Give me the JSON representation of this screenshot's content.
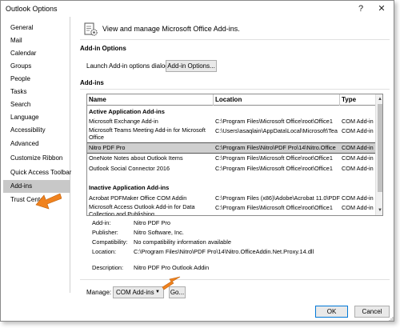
{
  "window": {
    "title": "Outlook Options",
    "help_glyph": "?",
    "close_glyph": "✕"
  },
  "sidebar": {
    "items": [
      "General",
      "Mail",
      "Calendar",
      "Groups",
      "People",
      "Tasks",
      "Search",
      "Language",
      "Accessibility",
      "Advanced",
      "Customize Ribbon",
      "Quick Access Toolbar",
      "Add-ins",
      "Trust Center"
    ],
    "selected": "Add-ins"
  },
  "header": {
    "text": "View and manage Microsoft Office Add-ins.",
    "icon": "addins-gear-icon"
  },
  "addin_options": {
    "title": "Add-in Options",
    "launch_label": "Launch Add-in options dialog:",
    "button_label": "Add-in Options..."
  },
  "addins": {
    "title": "Add-ins",
    "columns": {
      "name": "Name",
      "location": "Location",
      "type": "Type"
    },
    "active_group": "Active Application Add-ins",
    "active": [
      {
        "name": "Microsoft Exchange Add-in",
        "location": "C:\\Program Files\\Microsoft Office\\root\\Office1",
        "type": "COM Add-in"
      },
      {
        "name": "Microsoft Teams Meeting Add-in for Microsoft Office",
        "location": "C:\\Users\\asaqlain\\AppData\\Local\\Microsoft\\Tea",
        "type": "COM Add-in"
      },
      {
        "name": "Nitro PDF Pro",
        "location": "C:\\Program Files\\Nitro\\PDF Pro\\14\\Nitro.Office",
        "type": "COM Add-in"
      },
      {
        "name": "OneNote Notes about Outlook Items",
        "location": "C:\\Program Files\\Microsoft Office\\root\\Office1",
        "type": "COM Add-in"
      },
      {
        "name": "Outlook Social Connector 2016",
        "location": "C:\\Program Files\\Microsoft Office\\root\\Office1",
        "type": "COM Add-in"
      }
    ],
    "inactive_group": "Inactive Application Add-ins",
    "inactive": [
      {
        "name": "Acrobat PDFMaker Office COM Addin",
        "location": "C:\\Program Files (x86)\\Adobe\\Acrobat 11.0\\PDF",
        "type": "COM Add-in"
      },
      {
        "name": "Microsoft Access Outlook Add-in for Data Collection and Publishing",
        "location": "C:\\Program Files\\Microsoft Office\\root\\Office1",
        "type": "COM Add-in"
      }
    ],
    "selected_index": 2
  },
  "details": {
    "addin_label": "Add-in:",
    "addin": "Nitro PDF Pro",
    "publisher_label": "Publisher:",
    "publisher": "Nitro Software, Inc.",
    "compat_label": "Compatibility:",
    "compat": "No compatibility information available",
    "location_label": "Location:",
    "location": "C:\\Program Files\\Nitro\\PDF Pro\\14\\Nitro.OfficeAddin.Net.Proxy.14.dll",
    "description_label": "Description:",
    "description": "Nitro PDF Pro Outlook Addin"
  },
  "manage": {
    "label": "Manage:",
    "selected": "COM Add-ins",
    "go_label": "Go..."
  },
  "footer": {
    "ok_label": "OK",
    "cancel_label": "Cancel"
  },
  "colors": {
    "arrow": "#f0821e",
    "selected_bg": "#c8c8c8",
    "ok_border": "#0078d7"
  }
}
